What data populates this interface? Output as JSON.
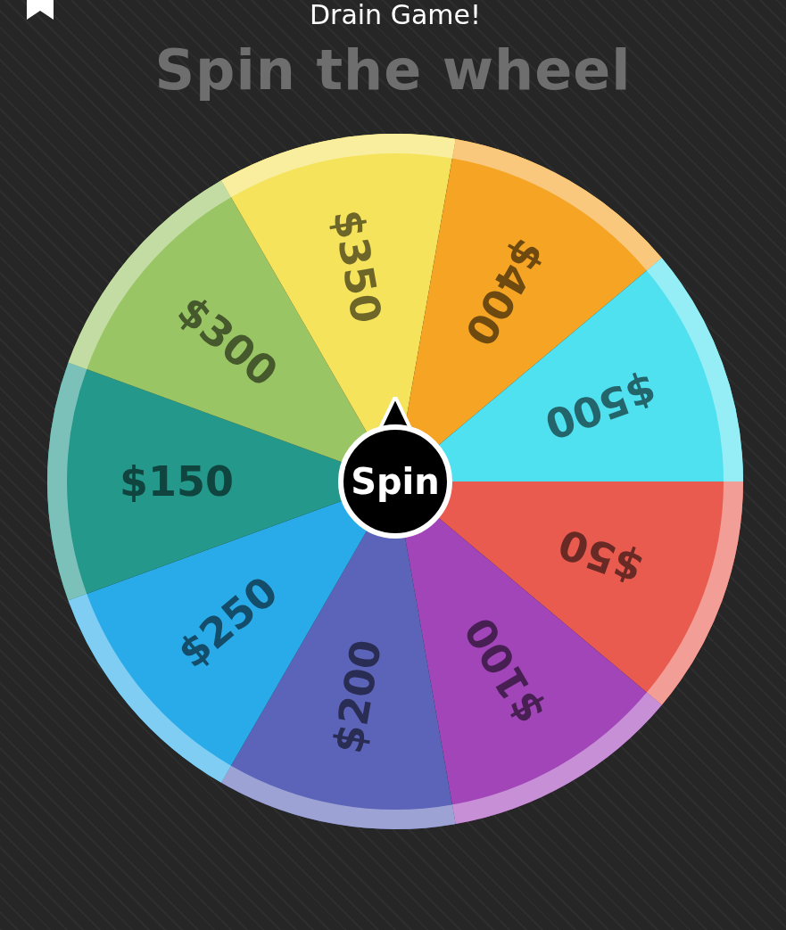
{
  "header": {
    "title": "Drain Game!"
  },
  "heading": "Spin the wheel",
  "wheel": {
    "segments": [
      {
        "label": "$50",
        "color": "#e95b4f"
      },
      {
        "label": "$100",
        "color": "#a145b9"
      },
      {
        "label": "$200",
        "color": "#5b64b9"
      },
      {
        "label": "$250",
        "color": "#2aabe9"
      },
      {
        "label": "$150",
        "color": "#23988b"
      },
      {
        "label": "$300",
        "color": "#99c565"
      },
      {
        "label": "$350",
        "color": "#f5e35b"
      },
      {
        "label": "$400",
        "color": "#f5a424"
      },
      {
        "label": "$500",
        "color": "#4fe1ef"
      }
    ],
    "spin_button": "Spin"
  }
}
